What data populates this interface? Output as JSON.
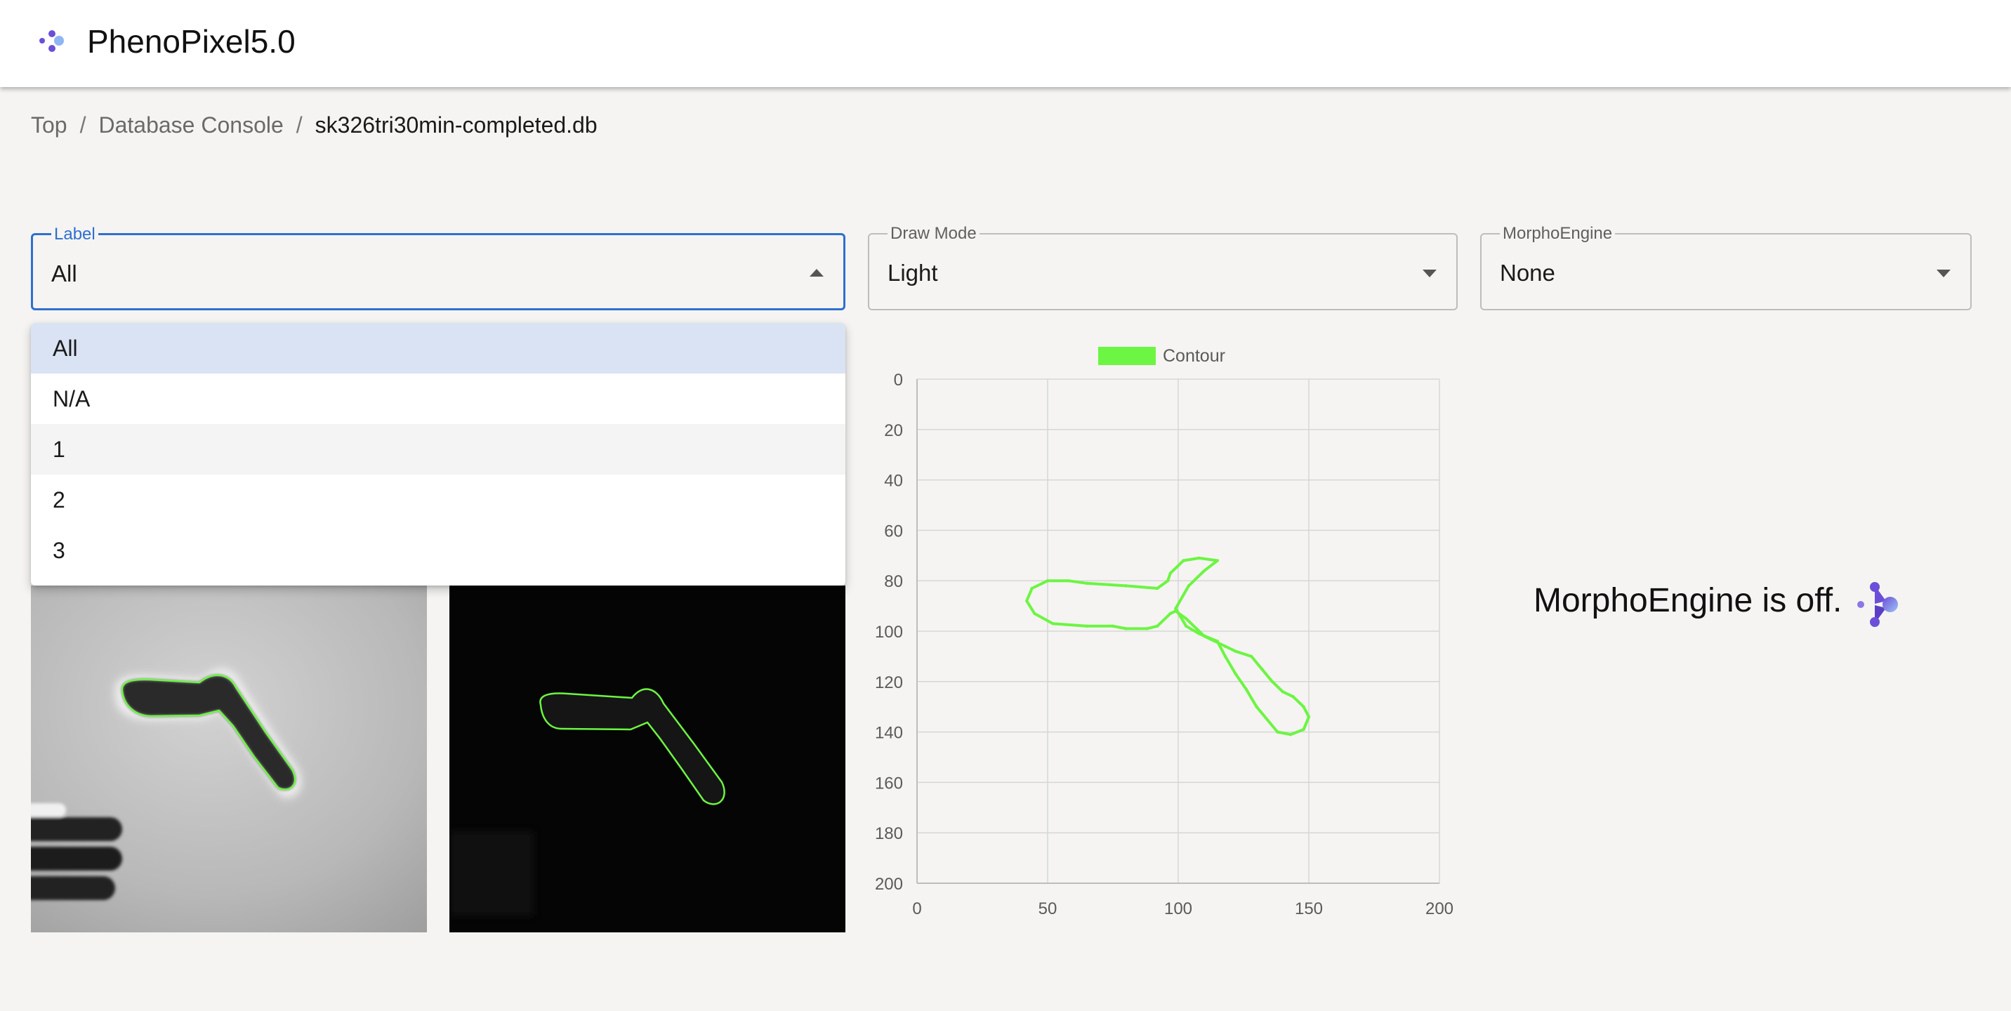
{
  "app": {
    "title": "PhenoPixel5.0",
    "logo_icon": "phenopixel-logo-icon"
  },
  "breadcrumb": {
    "items": [
      "Top",
      "Database Console",
      "sk326tri30min-completed.db"
    ],
    "separator": "/"
  },
  "selects": {
    "label": {
      "legend": "Label",
      "value": "All",
      "open": true
    },
    "draw_mode": {
      "legend": "Draw Mode",
      "value": "Light"
    },
    "morpho_engine": {
      "legend": "MorphoEngine",
      "value": "None"
    }
  },
  "label_menu": {
    "options": [
      "All",
      "N/A",
      "1",
      "2",
      "3"
    ],
    "selected": "All"
  },
  "morpho_status": {
    "text": "MorphoEngine is off.",
    "icon": "morphoengine-icon"
  },
  "colors": {
    "accent": "#2f6fce",
    "contour": "#6cf542",
    "menu_selected": "#dae3f3"
  },
  "chart_data": {
    "type": "scatter",
    "series": [
      {
        "name": "Contour",
        "points": [
          [
            50,
            80
          ],
          [
            44,
            83
          ],
          [
            42,
            88
          ],
          [
            45,
            93
          ],
          [
            52,
            97
          ],
          [
            65,
            98
          ],
          [
            75,
            98
          ],
          [
            80,
            99
          ],
          [
            88,
            99
          ],
          [
            92,
            98
          ],
          [
            97,
            93
          ],
          [
            99,
            92
          ],
          [
            103,
            95
          ],
          [
            110,
            102
          ],
          [
            118,
            106
          ],
          [
            122,
            108
          ],
          [
            128,
            110
          ],
          [
            132,
            115
          ],
          [
            136,
            120
          ],
          [
            140,
            124
          ],
          [
            144,
            126
          ],
          [
            148,
            130
          ],
          [
            150,
            134
          ],
          [
            148,
            139
          ],
          [
            143,
            141
          ],
          [
            138,
            140
          ],
          [
            130,
            130
          ],
          [
            126,
            123
          ],
          [
            122,
            117
          ],
          [
            118,
            110
          ],
          [
            115,
            104
          ],
          [
            108,
            101
          ],
          [
            103,
            98
          ],
          [
            99,
            91
          ],
          [
            104,
            82
          ],
          [
            110,
            76
          ],
          [
            115,
            72
          ],
          [
            108,
            71
          ],
          [
            102,
            72
          ],
          [
            97,
            77
          ],
          [
            96,
            80
          ],
          [
            92,
            83
          ],
          [
            80,
            82
          ],
          [
            65,
            81
          ],
          [
            58,
            80
          ],
          [
            50,
            80
          ]
        ]
      }
    ],
    "xlim": [
      0,
      200
    ],
    "ylim": [
      0,
      200
    ],
    "y_reversed": true,
    "xticks": [
      0,
      50,
      100,
      150,
      200
    ],
    "yticks": [
      0,
      20,
      40,
      60,
      80,
      100,
      120,
      140,
      160,
      180,
      200
    ],
    "grid": true,
    "legend": "top-center"
  }
}
